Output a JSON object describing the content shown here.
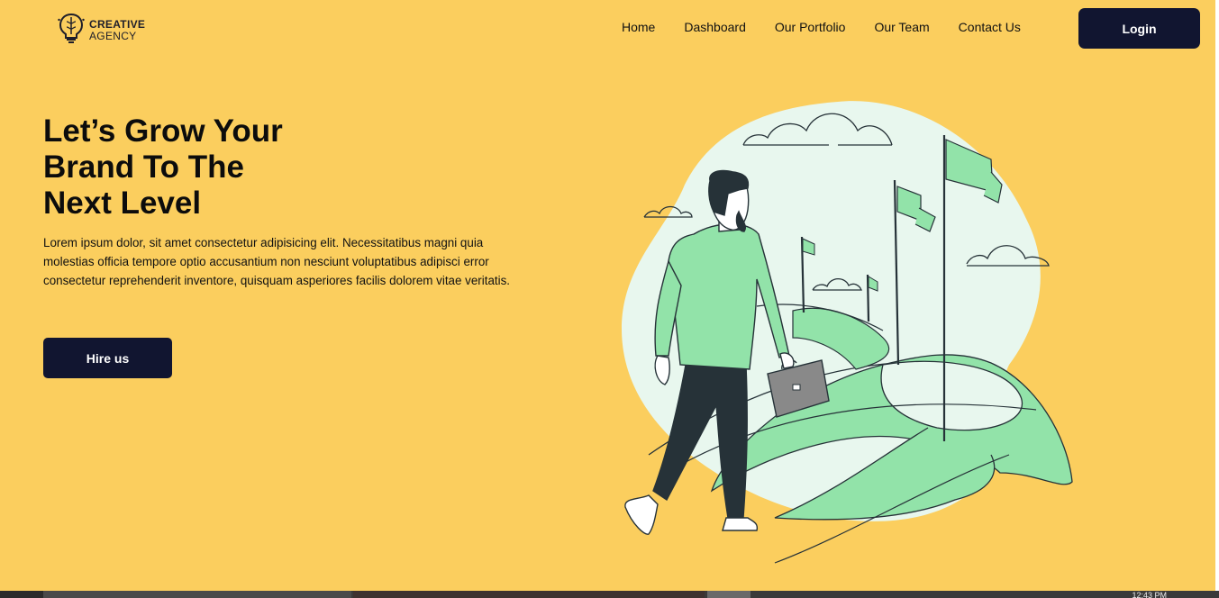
{
  "header": {
    "logo": {
      "line1": "CREATIVE",
      "line2": "AGENCY",
      "icon": "lightbulb-brain-icon"
    },
    "nav": [
      {
        "label": "Home"
      },
      {
        "label": "Dashboard"
      },
      {
        "label": "Our Portfolio"
      },
      {
        "label": "Our Team"
      },
      {
        "label": "Contact Us"
      }
    ],
    "login_label": "Login"
  },
  "hero": {
    "title_line1": "Let’s Grow Your",
    "title_line2": "Brand To The",
    "title_line3": "Next Level",
    "description": "Lorem ipsum dolor, sit amet consectetur adipisicing elit. Necessitatibus magni quia molestias officia tempore optio accusantium non nesciunt voluptatibus adipisci error consectetur reprehenderit inventore, quisquam asperiores facilis dolorem vitae veritatis.",
    "cta_label": "Hire us",
    "illustration": "businessman-walking-toward-flags-illustration"
  },
  "taskbar": {
    "clock": "12:43 PM"
  },
  "colors": {
    "background": "#fbce5e",
    "button": "#111530",
    "accent_green": "#92e3a9",
    "blob": "#e8f7ee",
    "ink": "#263238"
  }
}
